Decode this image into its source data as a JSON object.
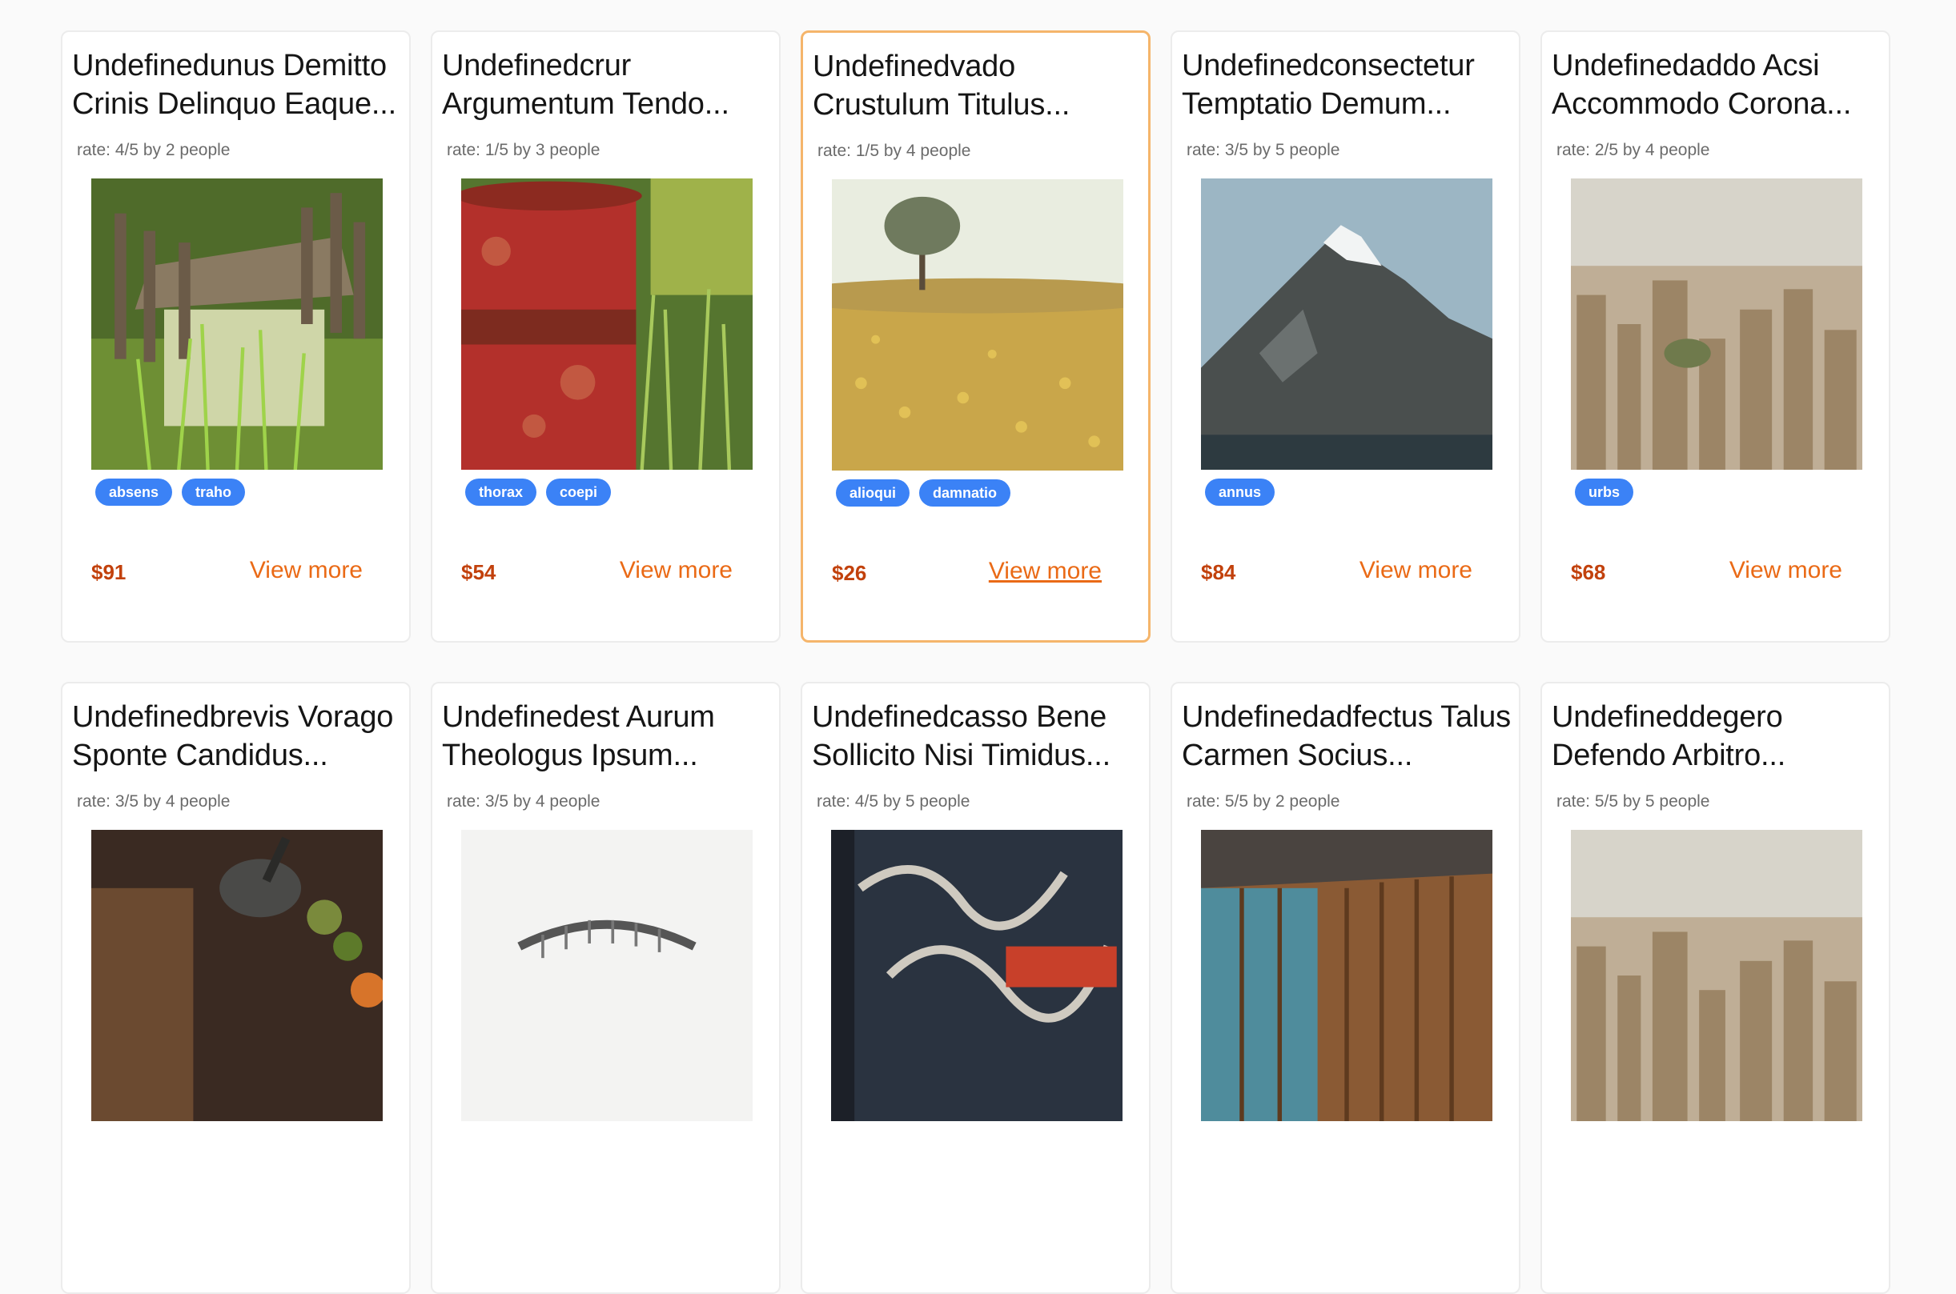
{
  "cards": [
    {
      "title": "Undefinedunus Demitto Crinis Delinquo Eaque...",
      "rate": "rate: 4/5 by 2 people",
      "image": "pier-in-reeds",
      "tags": [
        "absens",
        "traho"
      ],
      "price": "$91",
      "action": "View more"
    },
    {
      "title": "Undefinedcrur Argumentum Tendo...",
      "rate": "rate: 1/5 by 3 people",
      "image": "rusty-red-barrel",
      "tags": [
        "thorax",
        "coepi"
      ],
      "price": "$54",
      "action": "View more"
    },
    {
      "title": "Undefinedvado Crustulum Titulus...",
      "rate": "rate: 1/5 by 4 people",
      "image": "tree-in-yellow-field",
      "tags": [
        "alioqui",
        "damnatio"
      ],
      "price": "$26",
      "action": "View more"
    },
    {
      "title": "Undefinedconsectetur Temptatio Demum...",
      "rate": "rate: 3/5 by 5 people",
      "image": "snowy-mountain-lake",
      "tags": [
        "annus"
      ],
      "price": "$84",
      "action": "View more"
    },
    {
      "title": "Undefinedaddo Acsi Accommodo Corona...",
      "rate": "rate: 2/5 by 4 people",
      "image": "city-skyline",
      "tags": [
        "urbs"
      ],
      "price": "$68",
      "action": "View more"
    },
    {
      "title": "Undefinedbrevis Vorago Sponte Candidus...",
      "rate": "rate: 3/5 by 4 people",
      "image": "mortar-and-herbs",
      "tags": [],
      "price": "",
      "action": ""
    },
    {
      "title": "Undefinedest Aurum Theologus Ipsum...",
      "rate": "rate: 3/5 by 4 people",
      "image": "white-object",
      "tags": [],
      "price": "",
      "action": ""
    },
    {
      "title": "Undefinedcasso Bene Sollicito Nisi Timidus...",
      "rate": "rate: 4/5 by 5 people",
      "image": "graffiti-wall",
      "tags": [],
      "price": "",
      "action": ""
    },
    {
      "title": "Undefinedadfectus Talus Carmen Socius...",
      "rate": "rate: 5/5 by 2 people",
      "image": "wooden-shack",
      "tags": [],
      "price": "",
      "action": ""
    },
    {
      "title": "Undefineddegero Defendo Arbitro...",
      "rate": "rate: 5/5 by 5 people",
      "image": "city-skyline",
      "tags": [],
      "price": "",
      "action": ""
    }
  ],
  "colors": {
    "tag": "#3b82f6",
    "price": "#c2410c",
    "link": "#ea6a16",
    "active_border": "#f5b56b"
  }
}
